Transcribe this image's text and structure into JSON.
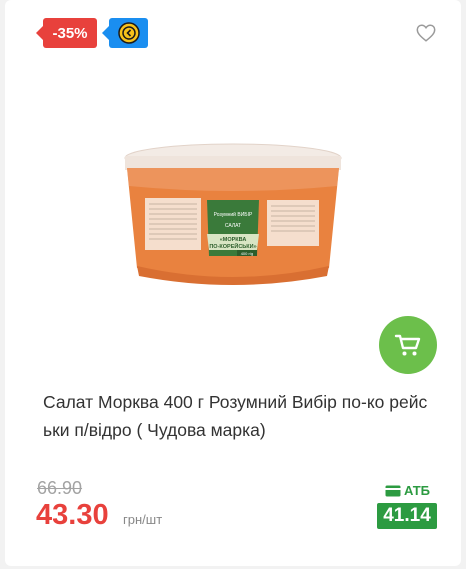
{
  "badges": {
    "discount": "-35%",
    "coin_icon": "coin-icon"
  },
  "product": {
    "title": "Салат Морква 400 г Розумний Вибір по-ко рейськи п/відро ( Чудова марка)",
    "image_label_brand": "Розумний ВИБІР",
    "image_label_type": "САЛАТ",
    "image_label_name_1": "«МОРКВА",
    "image_label_name_2": "ПО-КОРЕЙСЬКИ»",
    "image_label_weight": "400 г/g"
  },
  "price": {
    "old": "66.90",
    "current": "43.30",
    "unit": "грн/шт"
  },
  "store": {
    "label": "АТБ",
    "price": "41.14"
  },
  "colors": {
    "discount": "#e8413c",
    "coin_badge": "#1a8ef0",
    "cart": "#6cbf4b",
    "store_green": "#2c9b41"
  }
}
